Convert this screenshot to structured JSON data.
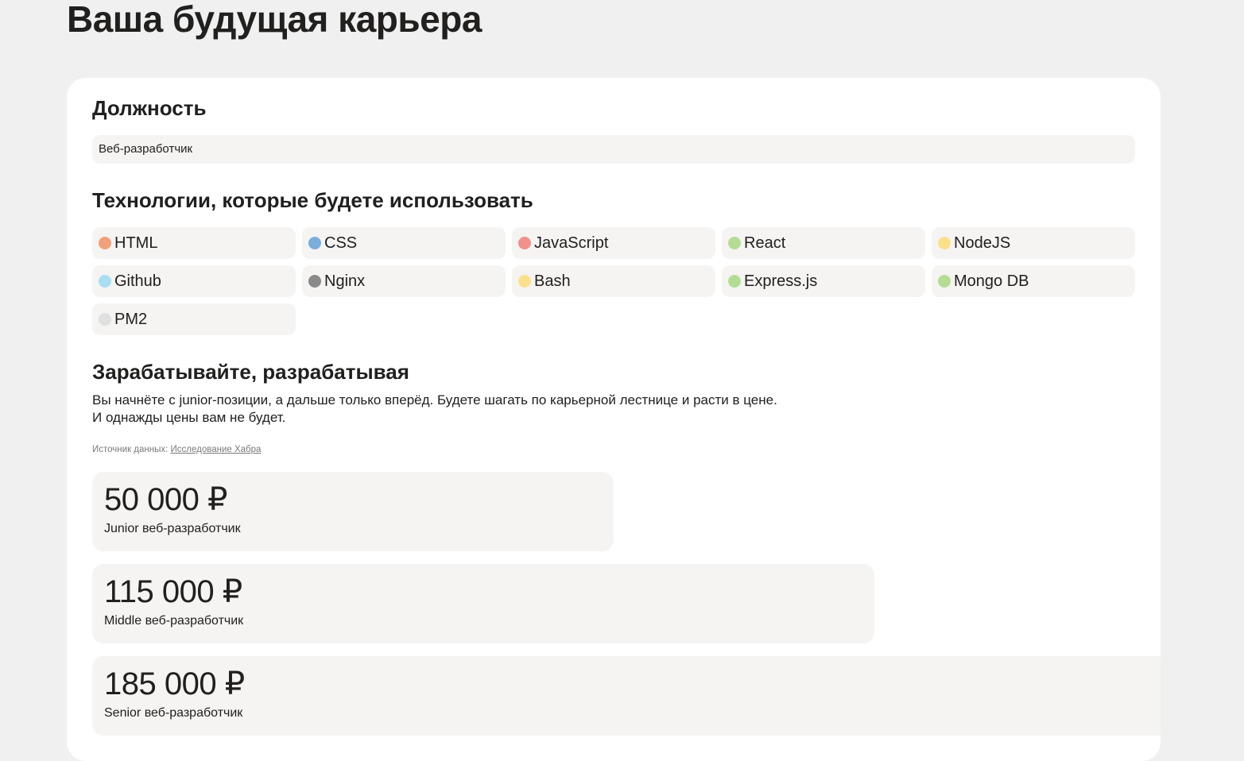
{
  "page": {
    "title": "Ваша будущая карьера"
  },
  "position": {
    "heading": "Должность",
    "value": "Веб-разработчик"
  },
  "technologies": {
    "heading": "Технологии, которые будете использовать",
    "items": [
      {
        "label": "HTML",
        "color": "#f2a07b"
      },
      {
        "label": "CSS",
        "color": "#7aaedb"
      },
      {
        "label": "JavaScript",
        "color": "#f0918a"
      },
      {
        "label": "React",
        "color": "#b5dc95"
      },
      {
        "label": "NodeJS",
        "color": "#fbe08c"
      },
      {
        "label": "Github",
        "color": "#a7def2"
      },
      {
        "label": "Nginx",
        "color": "#8a8a8a"
      },
      {
        "label": "Bash",
        "color": "#fbe08c"
      },
      {
        "label": "Express.js",
        "color": "#b5dc95"
      },
      {
        "label": "Mongo DB",
        "color": "#b5dc95"
      },
      {
        "label": "PM2",
        "color": "#e0e0e0"
      }
    ]
  },
  "earnings": {
    "heading": "Зарабатывайте, разрабатывая",
    "line1": "Вы начнёте с junior-позиции, а дальше только вперёд. Будете шагать по карьерной лестнице и расти в цене.",
    "line2": "И однажды цены вам не будет.",
    "source_label": "Источник данных:",
    "source_link": "Исследование Хабра",
    "salaries": [
      {
        "value": "50 000 ₽",
        "role": "Junior веб-разработчик"
      },
      {
        "value": "115 000 ₽",
        "role": "Middle веб-разработчик"
      },
      {
        "value": "185 000 ₽",
        "role": "Senior веб-разработчик"
      }
    ]
  }
}
